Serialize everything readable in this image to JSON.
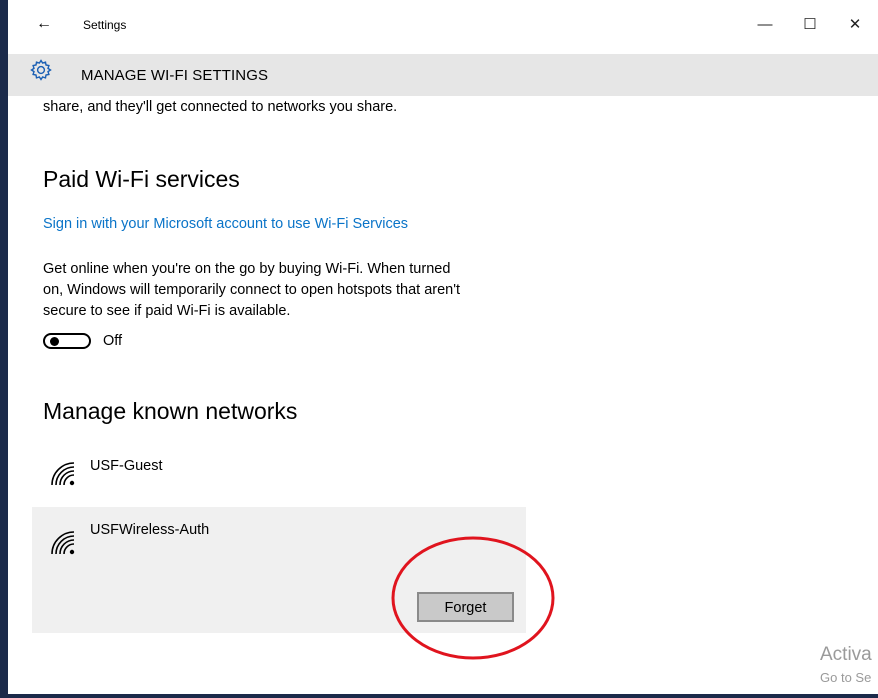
{
  "titlebar": {
    "back_icon": "back-arrow-icon",
    "title": "Settings",
    "minimize": "—",
    "maximize": "☐",
    "close": "✕"
  },
  "header": {
    "icon": "gear-icon",
    "title": "MANAGE WI-FI SETTINGS"
  },
  "content": {
    "intro_tail": "share, and they'll get connected to networks you share.",
    "paid_section": {
      "heading": "Paid Wi-Fi services",
      "link": "Sign in with your Microsoft account to use Wi-Fi Services",
      "description_lines": [
        "Get online when you're on the go by buying Wi-Fi. When turned",
        "on, Windows will temporarily connect to open hotspots that aren't",
        "secure to see if paid Wi-Fi is available."
      ],
      "toggle_state": "Off"
    },
    "known_section": {
      "heading": "Manage known networks",
      "networks": [
        {
          "name": "USF-Guest",
          "icon": "wifi-icon"
        },
        {
          "name": "USFWireless-Auth",
          "icon": "wifi-icon",
          "selected": true
        }
      ],
      "forget_button": "Forget"
    }
  },
  "watermark": {
    "title": "Activa",
    "subtitle": "Go to Se"
  },
  "colors": {
    "link": "#0a74c8",
    "header_bg": "#e6e6e6",
    "selected_bg": "#f0f0f0",
    "annotation": "#e0141e"
  }
}
